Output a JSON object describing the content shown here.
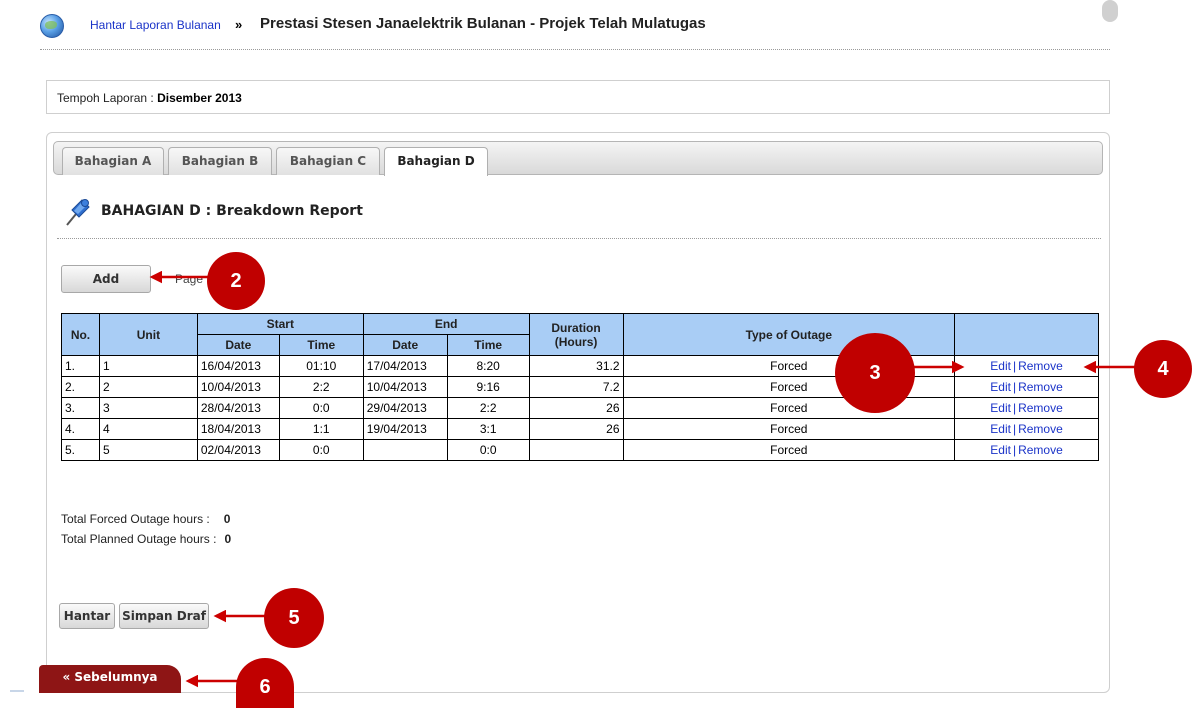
{
  "breadcrumb": {
    "link": "Hantar Laporan Bulanan",
    "separator": "»",
    "title": "Prestasi Stesen Janaelektrik Bulanan - Projek Telah Mulatugas"
  },
  "period": {
    "label": "Tempoh Laporan : ",
    "value": "Disember 2013"
  },
  "tabs": [
    {
      "label": "Bahagian A",
      "active": false
    },
    {
      "label": "Bahagian B",
      "active": false
    },
    {
      "label": "Bahagian C",
      "active": false
    },
    {
      "label": "Bahagian D",
      "active": true
    }
  ],
  "section": {
    "icon": "pushpin-icon",
    "title": "BAHAGIAN D : Breakdown Report"
  },
  "toolbar": {
    "add_label": "Add",
    "pager_text": "Page"
  },
  "table": {
    "headers": {
      "no": "No.",
      "unit": "Unit",
      "start": "Start",
      "end": "End",
      "date": "Date",
      "time": "Time",
      "duration": "Duration",
      "duration_unit": "(Hours)",
      "type": "Type of Outage"
    },
    "rows": [
      {
        "no": "1.",
        "unit": "1",
        "start_date": "16/04/2013",
        "start_time": "01:10",
        "end_date": "17/04/2013",
        "end_time": "8:20",
        "duration": "31.2",
        "type": "Forced"
      },
      {
        "no": "2.",
        "unit": "2",
        "start_date": "10/04/2013",
        "start_time": "2:2",
        "end_date": "10/04/2013",
        "end_time": "9:16",
        "duration": "7.2",
        "type": "Forced"
      },
      {
        "no": "3.",
        "unit": "3",
        "start_date": "28/04/2013",
        "start_time": "0:0",
        "end_date": "29/04/2013",
        "end_time": "2:2",
        "duration": "26",
        "type": "Forced"
      },
      {
        "no": "4.",
        "unit": "4",
        "start_date": "18/04/2013",
        "start_time": "1:1",
        "end_date": "19/04/2013",
        "end_time": "3:1",
        "duration": "26",
        "type": "Forced"
      },
      {
        "no": "5.",
        "unit": "5",
        "start_date": "02/04/2013",
        "start_time": "0:0",
        "end_date": "",
        "end_time": "0:0",
        "duration": "",
        "type": "Forced"
      }
    ],
    "actions": {
      "edit": "Edit",
      "separator": "|",
      "remove": "Remove"
    }
  },
  "totals": {
    "forced_label": "Total Forced Outage hours :",
    "forced_value": "0",
    "planned_label": "Total Planned Outage hours :",
    "planned_value": "0"
  },
  "buttons": {
    "submit": "Hantar",
    "save_draft": "Simpan Draf",
    "previous": "« Sebelumnya"
  },
  "callouts": [
    "2",
    "3",
    "4",
    "5",
    "6"
  ],
  "colors": {
    "accent": "#c00000",
    "header_bg": "#a9cdf5",
    "link": "#1a33c8",
    "prev_button": "#8e1515"
  }
}
